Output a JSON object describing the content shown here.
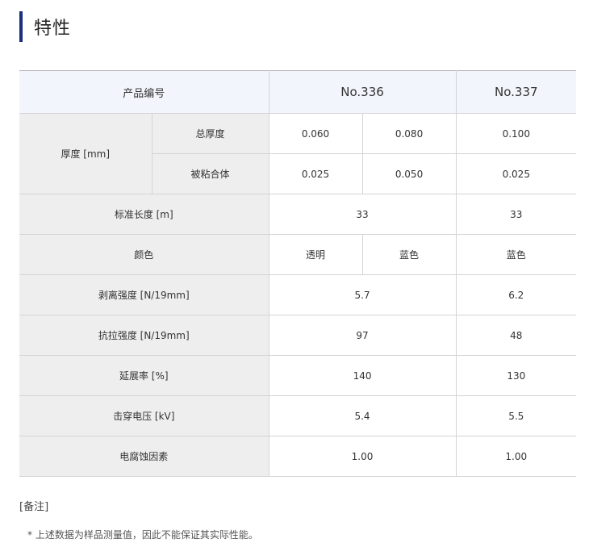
{
  "section": {
    "title": "特性"
  },
  "table": {
    "header": {
      "product_label": "产品编号",
      "models": [
        "No.336",
        "No.337"
      ]
    },
    "thickness": {
      "label": "厚度 [mm]",
      "total_label": "总厚度",
      "total_values": [
        "0.060",
        "0.080",
        "0.100"
      ],
      "adherend_label": "被粘合体",
      "adherend_values": [
        "0.025",
        "0.050",
        "0.025"
      ]
    },
    "length": {
      "label": "标准长度 [m]",
      "values": [
        "33",
        "33"
      ]
    },
    "color": {
      "label": "颜色",
      "values": [
        "透明",
        "蓝色",
        "蓝色"
      ]
    },
    "peel": {
      "label": "剥离强度 [N/19mm]",
      "values": [
        "5.7",
        "6.2"
      ]
    },
    "tensile": {
      "label": "抗拉强度 [N/19mm]",
      "values": [
        "97",
        "48"
      ]
    },
    "elongation": {
      "label": "延展率 [%]",
      "values": [
        "140",
        "130"
      ]
    },
    "breakdown": {
      "label": "击穿电压 [kV]",
      "values": [
        "5.4",
        "5.5"
      ]
    },
    "corrosion": {
      "label": "电腐蚀因素",
      "values": [
        "1.00",
        "1.00"
      ]
    }
  },
  "notes": {
    "title": "[备注]",
    "text": "* 上述数据为样品测量值，因此不能保证其实际性能。"
  }
}
